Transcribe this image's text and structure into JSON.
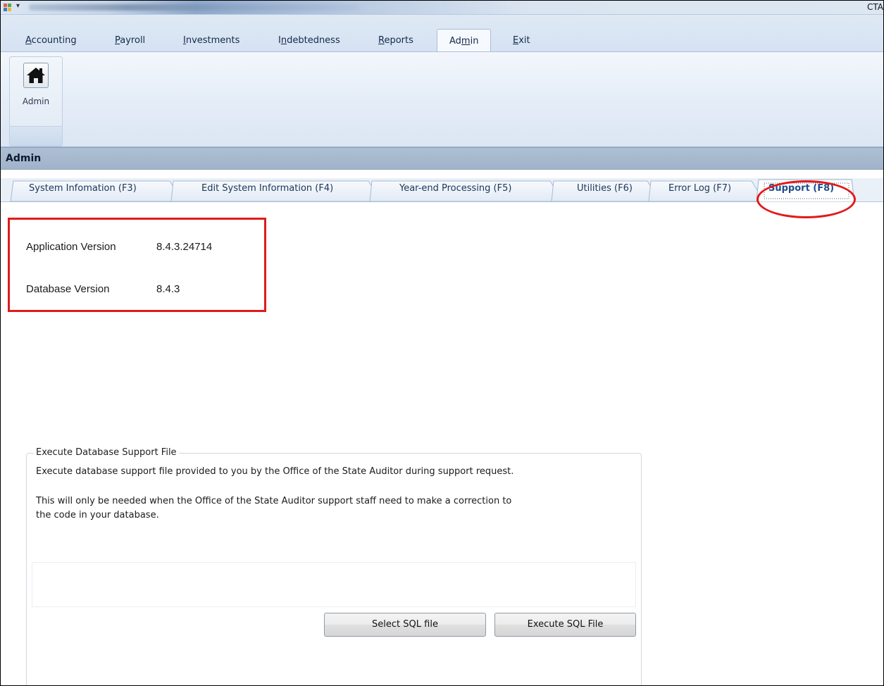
{
  "titlebar": {
    "right_text": "CTA",
    "qat_glyph": "▾"
  },
  "menu": {
    "tabs": [
      {
        "label_pre": "",
        "underline": "A",
        "label_post": "ccounting",
        "active": false
      },
      {
        "label_pre": "",
        "underline": "P",
        "label_post": "ayroll",
        "active": false
      },
      {
        "label_pre": "",
        "underline": "I",
        "label_post": "nvestments",
        "active": false
      },
      {
        "label_pre": "I",
        "underline": "n",
        "label_post": "debtedness",
        "active": false
      },
      {
        "label_pre": "",
        "underline": "R",
        "label_post": "eports",
        "active": false
      },
      {
        "label_pre": "Ad",
        "underline": "m",
        "label_post": "in",
        "active": true
      },
      {
        "label_pre": "",
        "underline": "E",
        "label_post": "xit",
        "active": false
      }
    ]
  },
  "ribbon": {
    "group_button_label": "Admin",
    "group_icon": "home-icon"
  },
  "section": {
    "title": "Admin"
  },
  "subtabs": [
    {
      "label": "System Infomation (F3)",
      "active": false
    },
    {
      "label": "Edit System Information (F4)",
      "active": false
    },
    {
      "label": "Year-end Processing  (F5)",
      "active": false
    },
    {
      "label": "Utilities (F6)",
      "active": false
    },
    {
      "label": "Error Log (F7)",
      "active": false
    },
    {
      "label": "Support (F8)",
      "active": true
    }
  ],
  "versions": {
    "app_label": "Application Version",
    "app_value": "8.4.3.24714",
    "db_label": "Database Version",
    "db_value": "8.4.3"
  },
  "support_file": {
    "legend": "Execute Database Support File",
    "description_1": "Execute database support file provided to you by the Office of the State Auditor during support request.",
    "description_2_line1": "This will only be needed when the Office of the State Auditor support staff need to make a correction to",
    "description_2_line2": "the code in your database.",
    "file_path": "",
    "select_button": "Select SQL file",
    "execute_button": "Execute SQL File"
  },
  "colors": {
    "annotation_red": "#e11a1a",
    "active_subtab_text": "#1f4d8c"
  }
}
